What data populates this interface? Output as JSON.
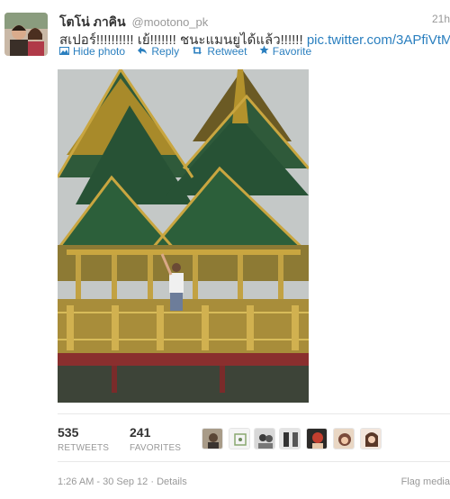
{
  "tweet": {
    "fullname": "โตโน่ ภาคิน",
    "handle": "@mootono_pk",
    "time_ago": "21h",
    "text": "สเปอร์!!!!!!!!!! เย้!!!!!!! ชนะแมนยูได้แล้ว!!!!!! ",
    "link": "pic.twitter.com/3APfiVtM"
  },
  "actions": [
    {
      "label": "Hide photo",
      "icon": "photo-icon"
    },
    {
      "label": "Reply",
      "icon": "reply-icon"
    },
    {
      "label": "Retweet",
      "icon": "retweet-icon"
    },
    {
      "label": "Favorite",
      "icon": "star-icon"
    }
  ],
  "stats": {
    "retweets": {
      "count": "535",
      "label": "RETWEETS"
    },
    "favorites": {
      "count": "241",
      "label": "FAVORITES"
    }
  },
  "footer": {
    "timestamp": "1:26 AM - 30 Sep 12",
    "separator": " · ",
    "details": "Details",
    "flag": "Flag media"
  },
  "colors": {
    "link": "#2a7fbf",
    "muted": "#999999",
    "text": "#333333"
  }
}
